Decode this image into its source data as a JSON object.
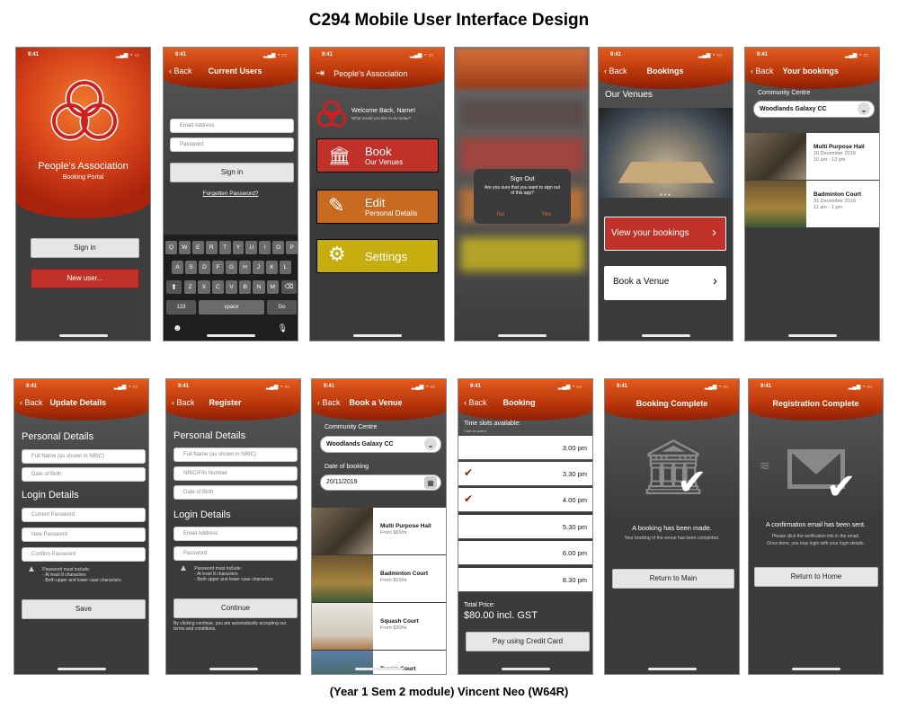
{
  "title": "C294 Mobile User Interface Design",
  "footer": "(Year 1 Sem 2 module)  Vincent Neo (W64R)",
  "status_time": "9:41",
  "colors": {
    "header": "#c0400f",
    "book": "#c0312a",
    "edit": "#c86a20",
    "settings": "#c6ae10"
  },
  "s1": {
    "brand": "People's Association",
    "sub": "Booking Portal",
    "signin": "Sign in",
    "newuser": "New user..."
  },
  "s2": {
    "back": "Back",
    "title": "Current Users",
    "email_ph": "Email Address",
    "password_ph": "Password",
    "signin": "Sign in",
    "forgot": "Forgetten Password?",
    "row1": [
      "Q",
      "W",
      "E",
      "R",
      "T",
      "Y",
      "U",
      "I",
      "O",
      "P"
    ],
    "row2": [
      "A",
      "S",
      "D",
      "F",
      "G",
      "H",
      "J",
      "K",
      "L"
    ],
    "row3": [
      "Z",
      "X",
      "C",
      "V",
      "B",
      "N",
      "M"
    ],
    "k123": "123",
    "space": "space",
    "go": "Go"
  },
  "s3": {
    "title": "People's Association",
    "welcome": "Welcome Back, Name!",
    "prompt": "What would you like to do today?",
    "book": "Book",
    "book_sub": "Our Venues",
    "edit": "Edit",
    "edit_sub": "Personal Details",
    "settings": "Settings"
  },
  "s4": {
    "dlg_title": "Sign Out",
    "dlg_msg": "Are you sure that you want to sign out of this app?",
    "no": "No",
    "yes": "Yes"
  },
  "s5": {
    "back": "Back",
    "title": "Bookings",
    "venues": "Our Venues",
    "view": "View your bookings",
    "book": "Book a Venue"
  },
  "s6": {
    "back": "Back",
    "title": "Your bookings",
    "cc_label": "Community Centre",
    "cc": "Woodlands Galaxy CC",
    "b1_name": "Multi Purpose Hall",
    "b1_date": "20 December 2019",
    "b1_time": "10 am - 12 pm",
    "b2_name": "Badminton Court",
    "b2_date": "31 December 2019",
    "b2_time": "11 am - 1 pm"
  },
  "s7": {
    "back": "Back",
    "title": "Update Details",
    "personal": "Personal Details",
    "fullname_ph": "Full Name (as shown in NRIC)",
    "dob_ph": "Date of Birth",
    "login": "Login Details",
    "cur_ph": "Current Password",
    "new_ph": "New Password",
    "conf_ph": "Confirm Password",
    "w1": "Password must include:",
    "w2": "- At least 8 characters",
    "w3": "- Both upper and lower case characters",
    "save": "Save"
  },
  "s8": {
    "back": "Back",
    "title": "Register",
    "personal": "Personal Details",
    "fullname_ph": "Full Name (as shown in NRIC)",
    "nric_ph": "NRIC/FIN Number",
    "dob_ph": "Date of Birth",
    "login": "Login Details",
    "email_ph": "Email Address",
    "pass_ph": "Password",
    "w1": "Password must include:",
    "w2": "- At least 8 characters",
    "w3": "- Both upper and lower case characters",
    "cont": "Continue",
    "terms": "By clicking continue, you are automatically accepting our terms and conditions."
  },
  "s9": {
    "back": "Back",
    "title": "Book a Venue",
    "cc_label": "Community Centre",
    "cc": "Woodlands Galaxy CC",
    "date_label": "Date of booking",
    "date": "20/11/2019",
    "v1": "Multi Purpose Hall",
    "p1": "From $65/hr",
    "v2": "Badminton Court",
    "p2": "From $10/hr",
    "v3": "Squash Court",
    "p3": "From $30/hr",
    "v4": "Tennis Court"
  },
  "s10": {
    "back": "Back",
    "title": "Booking",
    "slots": "Time slots available:",
    "hint": "Click to select",
    "times": [
      "3.00 pm",
      "3.30 pm",
      "4.00 pm",
      "5.30 pm",
      "6.00 pm",
      "8.30 pm"
    ],
    "total_label": "Total Price:",
    "total": "$80.00 incl. GST",
    "pay": "Pay using Credit Card"
  },
  "s11": {
    "title": "Booking Complete",
    "msg": "A booking has been made.",
    "sub": "Your booking of the venue has been completed.",
    "btn": "Return to Main"
  },
  "s12": {
    "title": "Registration Complete",
    "msg": "A confirmation email has been sent.",
    "sub1": "Please click the verification link in the email.",
    "sub2": "Once done, you may login with your login details.",
    "btn": "Return to Home"
  }
}
